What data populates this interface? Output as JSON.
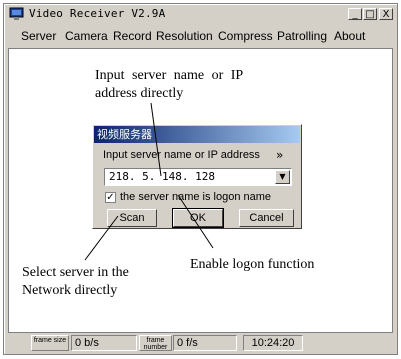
{
  "window": {
    "title": "Video Receiver V2.9A",
    "minimize_glyph": "_",
    "maximize_glyph": "□",
    "close_glyph": "X"
  },
  "menu": [
    "Server",
    "Camera",
    "Record",
    "Resolution",
    "Compress",
    "Patrolling",
    "About"
  ],
  "annotations": {
    "input_server": [
      "Input server name or IP",
      "address directly"
    ],
    "select_server": [
      "Select server in the",
      "Network directly"
    ],
    "enable_logon": "Enable logon function"
  },
  "dialog": {
    "title": "视频服务器",
    "prompt": "Input server name or IP address",
    "chevron": "»",
    "server_value": "218. 5. 148. 128",
    "checkbox_checked": true,
    "checkbox_label": "the server name is logon name",
    "scan_label": "Scan",
    "ok_label": "OK",
    "cancel_label": "Cancel"
  },
  "status": {
    "frame_size_label": "frame size",
    "bitrate": "0 b/s",
    "frame_number_label": "frame number",
    "fps": "0 f/s",
    "time": "10:24:20"
  }
}
